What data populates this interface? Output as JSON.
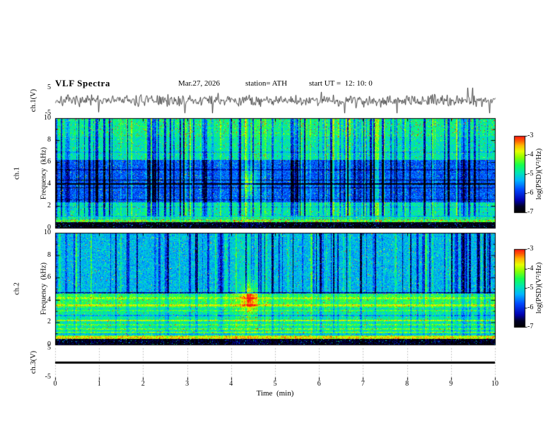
{
  "header": {
    "title": "VLF Spectra",
    "date": "Mar.27, 2026",
    "station": "station= ATH",
    "start_ut": "start UT =  12: 10: 0"
  },
  "x_axis": {
    "label": "Time  (min)",
    "min": 0,
    "max": 10,
    "ticks": [
      "0",
      "1",
      "2",
      "3",
      "4",
      "5",
      "6",
      "7",
      "8",
      "9",
      "10"
    ]
  },
  "panels": {
    "ch1_wave": {
      "ylabel": "ch.1(V)",
      "ymin": -5,
      "ymax": 5,
      "yticks": [
        "5",
        "-5"
      ]
    },
    "ch1_spec": {
      "ylabel_line1": "ch.1",
      "ylabel_line2": "Frequency  (kHz)",
      "ymin": 0,
      "ymax": 10,
      "yticks": [
        "10",
        "8",
        "6",
        "4",
        "2",
        "0"
      ]
    },
    "ch2_spec": {
      "ylabel_line1": "ch.2",
      "ylabel_line2": "Frequency  (kHz)",
      "ymin": 0,
      "ymax": 10,
      "yticks": [
        "10",
        "8",
        "6",
        "4",
        "2",
        "0"
      ]
    },
    "ch3_wave": {
      "ylabel": "ch.3(V)",
      "ymin": -5,
      "ymax": 5,
      "yticks": [
        "5",
        "-5"
      ]
    }
  },
  "colorbar": {
    "label": "log(PSD)(V²/Hz)",
    "min": -7,
    "max": -3,
    "ticks": [
      "-3",
      "-4",
      "-5",
      "-6",
      "-7"
    ]
  },
  "colormap_stops": [
    {
      "t": 0.0,
      "color": "#000000"
    },
    {
      "t": 0.08,
      "color": "#000028"
    },
    {
      "t": 0.16,
      "color": "#0000b0"
    },
    {
      "t": 0.3,
      "color": "#0048ff"
    },
    {
      "t": 0.42,
      "color": "#00b4ff"
    },
    {
      "t": 0.52,
      "color": "#00e6b4"
    },
    {
      "t": 0.62,
      "color": "#14ff50"
    },
    {
      "t": 0.72,
      "color": "#8cff00"
    },
    {
      "t": 0.8,
      "color": "#e6ff00"
    },
    {
      "t": 0.88,
      "color": "#ffb400"
    },
    {
      "t": 0.94,
      "color": "#ff5a00"
    },
    {
      "t": 1.0,
      "color": "#ff1414"
    }
  ],
  "chart_data": [
    {
      "type": "line",
      "name": "ch.1(V) time series",
      "xlabel": "Time (min)",
      "ylabel": "ch.1(V)",
      "xlim": [
        0,
        10
      ],
      "ylim": [
        -5,
        5
      ],
      "noise_std": 0.55,
      "spike_rate": 0.02,
      "spike_max": 4.5,
      "description": "broadband noise centred on 0 V with impulsive sferic spikes reaching about ±4 V"
    },
    {
      "type": "heatmap",
      "name": "ch.1 spectrogram",
      "xlabel": "Time (min)",
      "ylabel": "Frequency (kHz)",
      "zlabel": "log(PSD)(V²/Hz)",
      "xlim": [
        0,
        10
      ],
      "ylim": [
        0,
        10
      ],
      "zlim": [
        -7,
        -3
      ],
      "background_level": -4.9,
      "bands": [
        {
          "f": [
            0,
            0.5
          ],
          "dz": -2.0,
          "speckle": 0.05,
          "note": "black noise-floor band"
        },
        {
          "f": [
            0.5,
            0.78
          ],
          "dz": 0.55,
          "speckle": 0.12,
          "note": "bright speckled row"
        },
        {
          "f": [
            0.78,
            1.1
          ],
          "dz": -0.25
        },
        {
          "f": [
            2.3,
            6.2
          ],
          "dz": -0.85,
          "note": "quiet blue band"
        },
        {
          "f": [
            8.3,
            10
          ],
          "dz": 0.15,
          "speckle": 0.05
        }
      ],
      "lines": [
        {
          "f": 4.0,
          "dz": -1.7,
          "w": 0.09,
          "note": "black interference line"
        },
        {
          "f": 4.35,
          "dz": -1.0,
          "w": 0.05
        },
        {
          "f": 3.65,
          "dz": -0.8,
          "w": 0.05
        },
        {
          "f": 5.3,
          "dz": -0.5,
          "w": 0.05
        },
        {
          "f": 2.55,
          "dz": -0.6,
          "w": 0.05
        },
        {
          "f": 1.9,
          "dz": -0.4,
          "w": 0.05
        },
        {
          "f": 6.9,
          "dz": -0.35,
          "w": 0.05
        },
        {
          "f": 0.9,
          "dz": 0.5,
          "w": 0.06
        }
      ],
      "stripe_regions": [
        {
          "f": [
            1.1,
            10
          ],
          "gain": 1.0
        },
        {
          "f": [
            0,
            1.1
          ],
          "gain": 0.3
        }
      ],
      "event": {
        "t": 4.42,
        "f": 4.1,
        "dz": 1.5,
        "st": 0.1,
        "sf": 0.9,
        "note": "bright burst near 4.4 min"
      }
    },
    {
      "type": "heatmap",
      "name": "ch.2 spectrogram",
      "xlabel": "Time (min)",
      "ylabel": "Frequency (kHz)",
      "zlabel": "log(PSD)(V²/Hz)",
      "xlim": [
        0,
        10
      ],
      "ylim": [
        0,
        10
      ],
      "zlim": [
        -7,
        -3
      ],
      "background_level": -4.85,
      "bands": [
        {
          "f": [
            0,
            0.5
          ],
          "dz": -2.0,
          "speckle": 0.05,
          "note": "black noise-floor band"
        },
        {
          "f": [
            0.5,
            0.85
          ],
          "dz": 0.5,
          "speckle": 0.08,
          "note": "green band"
        },
        {
          "f": [
            0.85,
            1.05
          ],
          "dz": -0.3
        },
        {
          "f": [
            3.3,
            4.6
          ],
          "dz": 0.3,
          "note": "bright green band"
        },
        {
          "f": [
            4.6,
            10
          ],
          "dz": -0.4,
          "note": "striped blue region"
        }
      ],
      "lines": [
        {
          "f": 4.62,
          "dz": -1.3,
          "w": 0.07,
          "note": "dark line"
        },
        {
          "f": 4.15,
          "dz": 0.45,
          "w": 0.1
        },
        {
          "f": 3.5,
          "dz": 0.65,
          "w": 0.09
        },
        {
          "f": 3.05,
          "dz": 0.4,
          "w": 0.07
        },
        {
          "f": 2.6,
          "dz": -0.5,
          "w": 0.06
        },
        {
          "f": 2.15,
          "dz": 0.85,
          "w": 0.09,
          "note": "red-orange line"
        },
        {
          "f": 1.75,
          "dz": 0.5,
          "w": 0.07
        },
        {
          "f": 1.4,
          "dz": 0.55,
          "w": 0.06
        },
        {
          "f": 1.1,
          "dz": 0.65,
          "w": 0.06
        },
        {
          "f": 0.65,
          "dz": 0.55,
          "w": 0.12
        }
      ],
      "stripe_regions": [
        {
          "f": [
            4.6,
            10
          ],
          "gain": 1.0
        },
        {
          "f": [
            1.05,
            4.6
          ],
          "gain": 0.45
        },
        {
          "f": [
            0,
            1.05
          ],
          "gain": 0.25
        }
      ],
      "event": {
        "t": 4.42,
        "f": 4.2,
        "dz": 1.3,
        "st": 0.12,
        "sf": 0.9,
        "note": "bright burst near 4.4 min"
      }
    },
    {
      "type": "line",
      "name": "ch.3(V) time series",
      "xlim": [
        0,
        10
      ],
      "ylim": [
        -5,
        5
      ],
      "constant_value": 0,
      "description": "flat trace at 0 V for the whole interval (channel inactive)"
    }
  ]
}
